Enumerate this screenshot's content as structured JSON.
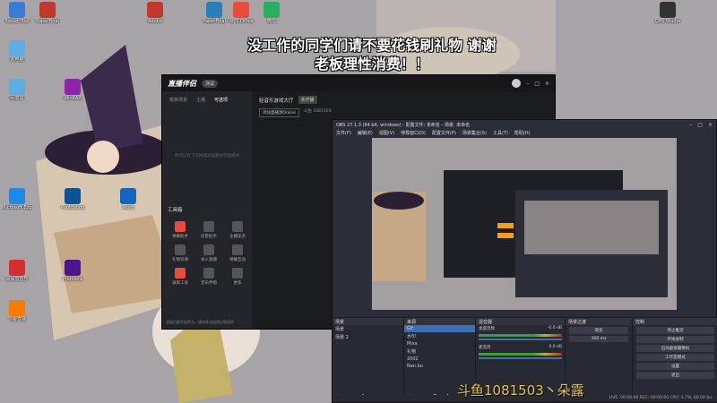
{
  "overlay": {
    "line1": "没工作的同学们请不要花钱刷礼物 谢谢",
    "line2": "老板理性消费！！"
  },
  "desktop_icons": [
    {
      "label": "Sweet Tool",
      "color": "#3a7bd5"
    },
    {
      "label": "PaperFinal",
      "color": "#c0392b"
    },
    {
      "label": "Adobe",
      "color": "#c0392b"
    },
    {
      "label": "PaperFinal",
      "color": "#2980b9"
    },
    {
      "label": "WPS Office",
      "color": "#e74c3c"
    },
    {
      "label": "微信",
      "color": "#27ae60"
    },
    {
      "label": "此电脑",
      "color": "#5dade2"
    },
    {
      "label": "回收站",
      "color": "#5dade2"
    },
    {
      "label": "Microsoft Edge",
      "color": "#1e88e5"
    },
    {
      "label": "Photoshop",
      "color": "#0b5394"
    },
    {
      "label": "Premiere",
      "color": "#4a148c"
    },
    {
      "label": "网易云音乐",
      "color": "#d32f2f"
    },
    {
      "label": "斗鱼直播",
      "color": "#f57c00"
    },
    {
      "label": "Word",
      "color": "#1565c0"
    },
    {
      "label": "OBS Studio",
      "color": "#333333"
    },
    {
      "label": "WinRAR",
      "color": "#8e24aa"
    }
  ],
  "companion": {
    "app_name": "直播伴侣",
    "badge": "测试",
    "tabs": [
      "模板场景",
      "主播",
      "可选项"
    ],
    "active_tab": "可选项",
    "stream_title": "轻音乐游戏大厅",
    "status": "未开播",
    "source_label": "添加直播源Online",
    "room_label": "斗鱼 1081503",
    "empty_hint": "你可以在下方拖拽添加素材到直播中",
    "tool_section": "工具箱",
    "tools": [
      "弹幕助手",
      "房管助手",
      "主播任务",
      "礼物答谢",
      "录入直播",
      "弹幕互动",
      "录屏工具",
      "音乐伴唱",
      "更多"
    ],
    "bottom_hint": "全局已经开启声卡，请勿多次启用以免回声"
  },
  "obs": {
    "title": "OBS 27.1.3 (64 bit, windows) - 配置文件: 未命名 - 场景: 未命名",
    "menu": [
      "文件(F)",
      "编辑(E)",
      "视图(V)",
      "停靠窗口(D)",
      "配置文件(P)",
      "场景集合(S)",
      "工具(T)",
      "帮助(H)"
    ],
    "scenes_header": "场景",
    "scenes": [
      "场景",
      "场景 2"
    ],
    "sources_header": "来源",
    "sources": [
      "Gif",
      "水印",
      "Mixa",
      "礼物",
      "2002",
      "Nan.bo"
    ],
    "mixer_header": "混音器",
    "mixer": [
      {
        "name": "桌面音频",
        "db": "-0.0 dB"
      },
      {
        "name": "麦克风",
        "db": "0.0 dB"
      }
    ],
    "transition_header": "场景过渡",
    "transition": "渐变",
    "duration": "300 ms",
    "controls_header": "控制",
    "controls": [
      "停止推流",
      "开始录制",
      "启动虚拟摄像机",
      "工作室模式",
      "设置",
      "退出"
    ],
    "status": "LIVE: 00:00:00  REC: 00:00:00  CPU: 3.7%, 60.00 fps"
  },
  "watermark": "斗鱼1081503丶朵露"
}
